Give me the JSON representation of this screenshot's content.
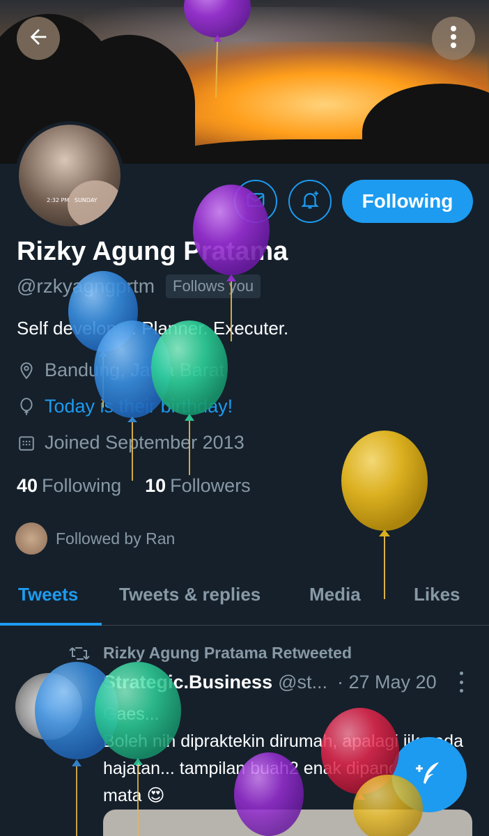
{
  "header": {
    "back_icon": "arrow-left-icon",
    "more_icon": "more-vertical-icon"
  },
  "profile": {
    "name": "Rizky Agung Pratama",
    "handle": "@rzkyagngprtm",
    "follows_you": "Follows you",
    "bio": "Self developer. Planner. Executer.",
    "location": "Bandung, Jawa Barat",
    "birthday": "Today is their birthday!",
    "joined": "Joined September 2013",
    "following_count": "40",
    "following_label": "Following",
    "followers_count": "10",
    "followers_label": "Followers",
    "followed_by": "Followed by Ran",
    "avatar_caption": "SUNDAY",
    "avatar_time": "2:32 PM"
  },
  "actions": {
    "message_icon": "mail-icon",
    "notify_icon": "bell-plus-icon",
    "following_button": "Following"
  },
  "tabs": [
    {
      "label": "Tweets",
      "active": true
    },
    {
      "label": "Tweets & replies",
      "active": false
    },
    {
      "label": "Media",
      "active": false
    },
    {
      "label": "Likes",
      "active": false
    }
  ],
  "tweet": {
    "retweet_label": "Rizky Agung Pratama Retweeted",
    "author": "Strategic.Business",
    "handle": "@st...",
    "date": "· 27 May 20",
    "line1": "Gaes...",
    "line2": "Boleh nih dipraktekin dirumah, apalagi jika ada hajatan... tampilan buah2 enak dipandang mata 😍"
  },
  "colors": {
    "background": "#15202b",
    "accent": "#1d9bf0",
    "secondary_text": "#8899a6"
  }
}
